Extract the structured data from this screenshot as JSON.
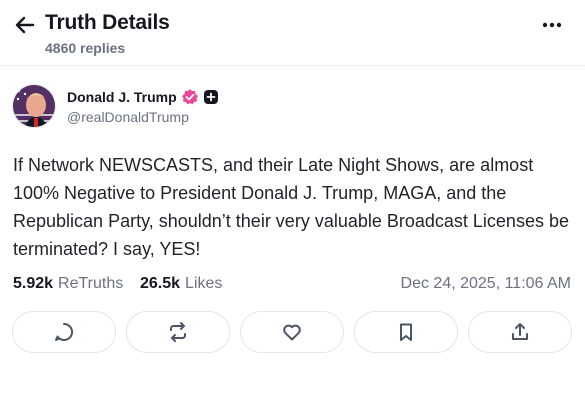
{
  "header": {
    "back_icon": "arrow-left-icon",
    "title": "Truth Details",
    "subtitle": "4860 replies",
    "more_icon": "more-horizontal-icon"
  },
  "post": {
    "author": {
      "display_name": "Donald J. Trump",
      "handle": "@realDonaldTrump",
      "verified_icon": "verified-badge-icon",
      "verified_color": "#ec4899",
      "extra_badge_icon": "plus-badge-icon"
    },
    "text": "If Network NEWSCASTS, and their Late Night Shows, are almost 100% Negative to President Donald J. Trump, MAGA, and the Republican Party, shouldn’t their very valuable Broadcast Licenses be terminated? I say, YES!",
    "stats": {
      "retruths_count": "5.92k",
      "retruths_label": "ReTruths",
      "likes_count": "26.5k",
      "likes_label": "Likes"
    },
    "timestamp": "Dec 24, 2025, 11:06 AM"
  },
  "actions": [
    {
      "icon": "reply-icon"
    },
    {
      "icon": "retruth-icon"
    },
    {
      "icon": "like-icon"
    },
    {
      "icon": "bookmark-icon"
    },
    {
      "icon": "share-icon"
    }
  ]
}
